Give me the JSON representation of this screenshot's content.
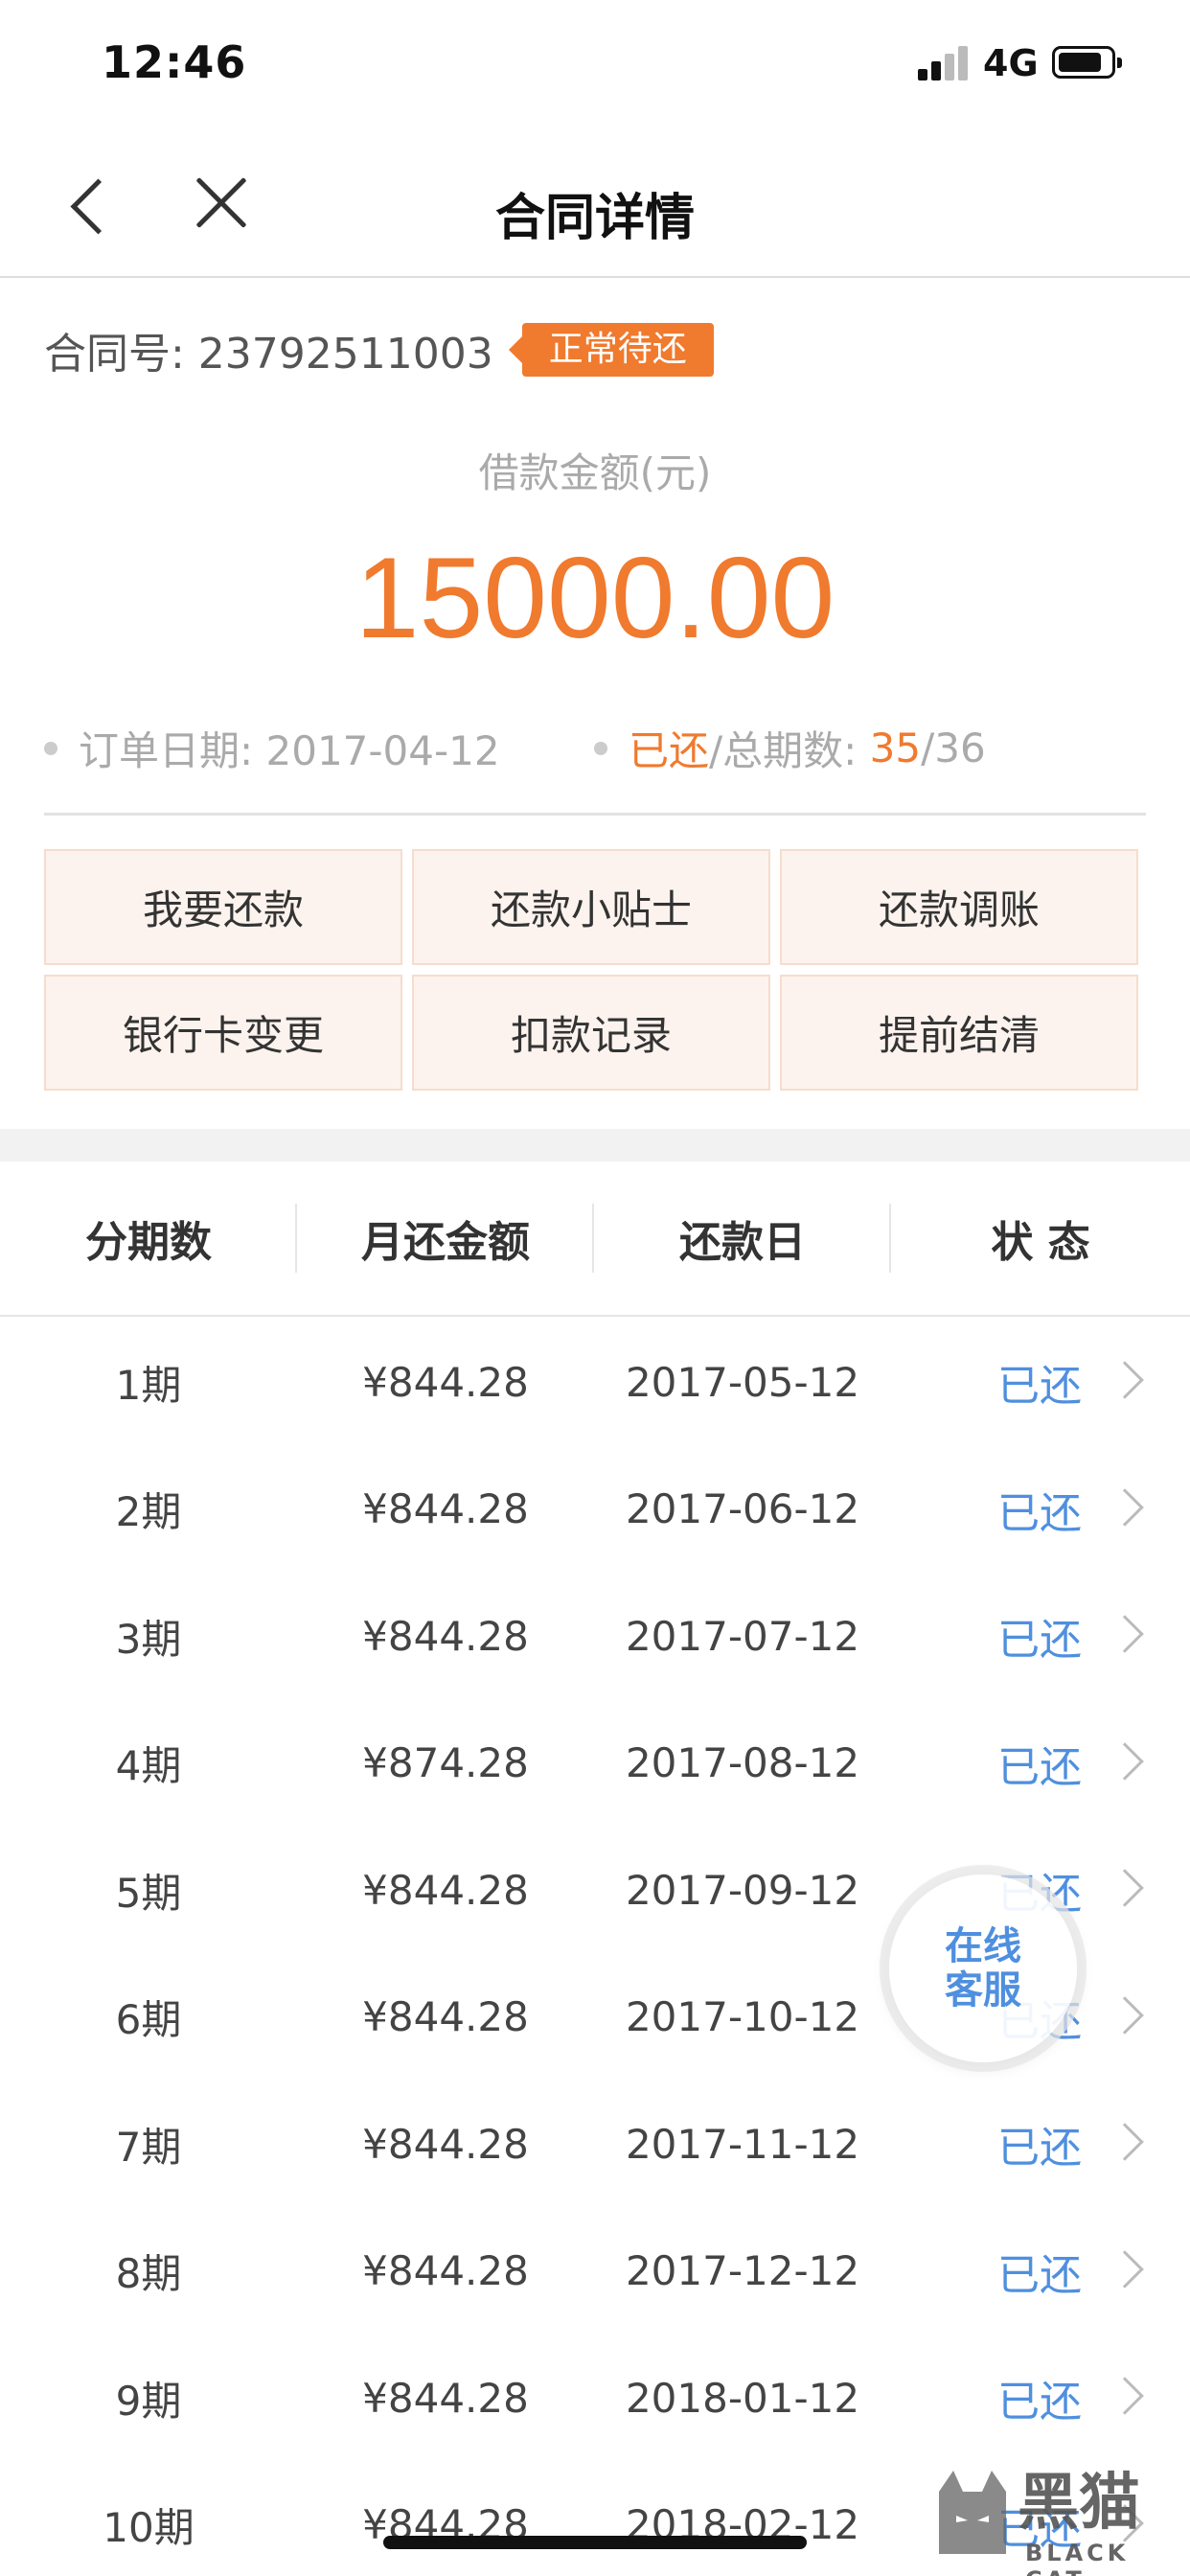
{
  "status_bar": {
    "time": "12:46",
    "network": "4G"
  },
  "nav": {
    "title": "合同详情"
  },
  "contract": {
    "label": "合同号: 23792511003",
    "status_badge": "正常待还",
    "amount_label": "借款金额(元)",
    "amount": "15000.00",
    "order_date": "订单日期: 2017-04-12",
    "paid_prefix": "已还",
    "paid_mid": "/总期数: ",
    "paid_count": "35",
    "total_count": "/36"
  },
  "actions": [
    "我要还款",
    "还款小贴士",
    "还款调账",
    "银行卡变更",
    "扣款记录",
    "提前结清"
  ],
  "table": {
    "headers": [
      "分期数",
      "月还金额",
      "还款日",
      "状 态"
    ],
    "rows": [
      {
        "period": "1期",
        "amount": "¥844.28",
        "date": "2017-05-12",
        "status": "已还"
      },
      {
        "period": "2期",
        "amount": "¥844.28",
        "date": "2017-06-12",
        "status": "已还"
      },
      {
        "period": "3期",
        "amount": "¥844.28",
        "date": "2017-07-12",
        "status": "已还"
      },
      {
        "period": "4期",
        "amount": "¥874.28",
        "date": "2017-08-12",
        "status": "已还"
      },
      {
        "period": "5期",
        "amount": "¥844.28",
        "date": "2017-09-12",
        "status": "已还"
      },
      {
        "period": "6期",
        "amount": "¥844.28",
        "date": "2017-10-12",
        "status": "已还"
      },
      {
        "period": "7期",
        "amount": "¥844.28",
        "date": "2017-11-12",
        "status": "已还"
      },
      {
        "period": "8期",
        "amount": "¥844.28",
        "date": "2017-12-12",
        "status": "已还"
      },
      {
        "period": "9期",
        "amount": "¥844.28",
        "date": "2018-01-12",
        "status": "已还"
      },
      {
        "period": "10期",
        "amount": "¥844.28",
        "date": "2018-02-12",
        "status": "已还"
      }
    ]
  },
  "float_service": {
    "line1": "在线",
    "line2": "客服"
  },
  "watermark": {
    "text": "黑猫",
    "sub": "BLACK CAT"
  },
  "colors": {
    "accent": "#f07a2e",
    "link": "#4f8fdf",
    "action_bg": "#fdf3ee"
  },
  "icons": [
    "signal-icon",
    "battery-icon",
    "back-icon",
    "close-icon",
    "chevron-right-icon"
  ]
}
